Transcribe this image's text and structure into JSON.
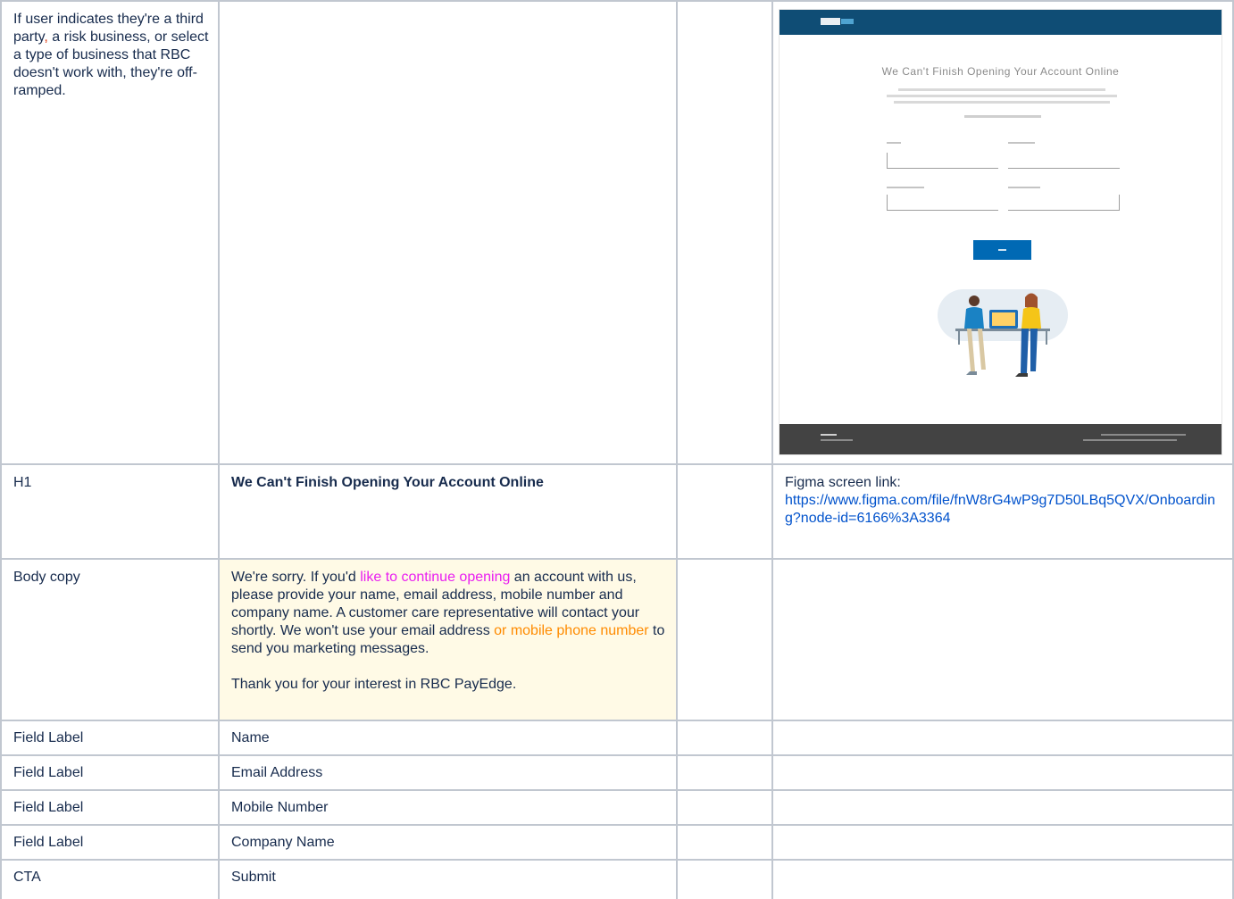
{
  "rows": [
    {
      "col1_parts": [
        {
          "text": "If user indicates they're a third party"
        },
        {
          "text": ",",
          "style": "red"
        },
        {
          "text": " a risk business, or select a type of business that RBC doesn't work with, they're off-ramped."
        }
      ]
    },
    {
      "col1": "H1",
      "col2": "We Can't Finish Opening Your Account Online",
      "col4_label": "Figma screen link:",
      "col4_link": "https://www.figma.com/file/fnW8rG4wP9g7D50LBq5QVX/Onboarding?node-id=6166%3A3364"
    },
    {
      "col1": "Body copy",
      "p1_a": "We're sorry. If you'd ",
      "p1_b": "like to continue opening",
      "p1_c": " an account with us, please provide your name, email address, mobile number and company name. A customer care representative will contact your shortly. We won't use your email address ",
      "p1_d": "or mobile phone number",
      "p1_e": " to send you marketing messages.",
      "p2": "Thank you for your interest in RBC PayEdge."
    },
    {
      "col1": "Field Label",
      "col2": "Name"
    },
    {
      "col1": "Field Label",
      "col2": "Email Address"
    },
    {
      "col1": "Field Label",
      "col2": "Mobile Number"
    },
    {
      "col1": "Field Label",
      "col2": "Company Name"
    },
    {
      "col1": "CTA",
      "col2": "Submit"
    }
  ],
  "mockup": {
    "title": "We Can't Finish Opening Your Account Online",
    "colors": {
      "header": "#0f4d75",
      "button": "#0069b4",
      "footer": "#434343"
    }
  },
  "colors": {
    "grid_border": "#c1c7d0",
    "highlight_bg": "#fffae6",
    "pink": "#e91ef0",
    "orange": "#ff8b00",
    "red": "#de350b",
    "link": "#0052cc"
  }
}
